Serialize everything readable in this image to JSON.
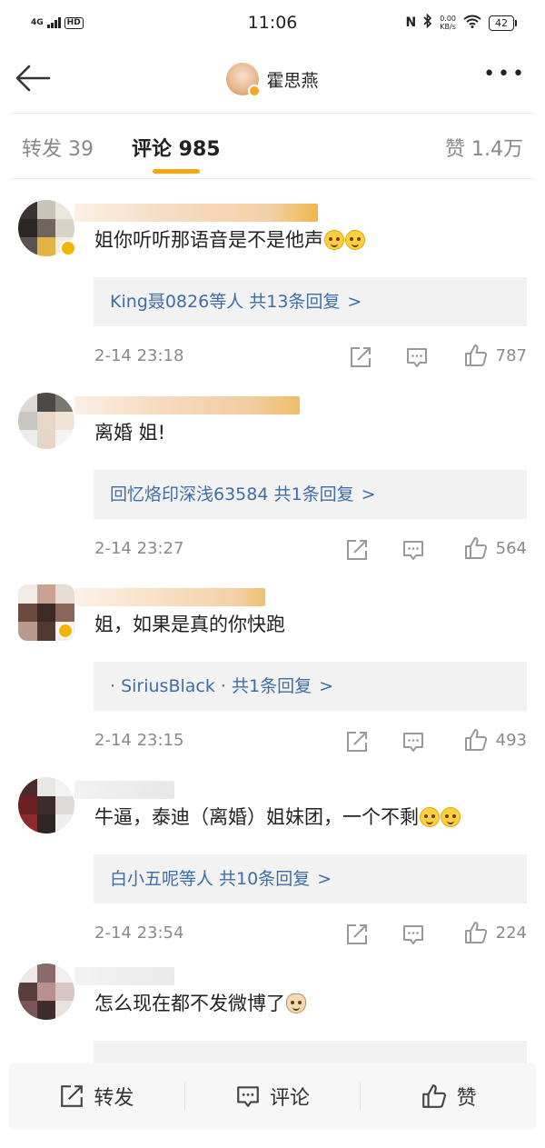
{
  "status_bar": {
    "network": "4G",
    "hd": "HD",
    "time": "11:06",
    "speed_value": "0.00",
    "speed_unit": "KB/s",
    "battery": "42"
  },
  "header": {
    "title": "霍思燕",
    "more": "•••"
  },
  "tabs": [
    {
      "label": "转发 39",
      "active": false
    },
    {
      "label": "评论 985",
      "active": true
    },
    {
      "label": "赞 1.4万",
      "active": false
    }
  ],
  "accent_color": "#f7a70f",
  "link_color": "#3d6ea8",
  "comments": [
    {
      "text": "姐你听听那语音是不是他声",
      "emojis": [
        "dizzy-face-emoji",
        "dizzy-face-emoji"
      ],
      "reply_summary": "King聂0826等人 共13条回复",
      "reply_chevron": ">",
      "time": "2-14 23:18",
      "likes": "787"
    },
    {
      "text": "离婚 姐!",
      "emojis": [],
      "reply_summary": "回忆烙印深浅63584 共1条回复",
      "reply_chevron": ">",
      "time": "2-14 23:27",
      "likes": "564"
    },
    {
      "text": "姐，如果是真的你快跑",
      "emojis": [],
      "reply_summary": "· SiriusBlack · 共1条回复",
      "reply_chevron": ">",
      "time": "2-14 23:15",
      "likes": "493"
    },
    {
      "text": "牛逼，泰迪（离婚）姐妹团，一个不剩",
      "emojis": [
        "sweat-smile-emoji",
        "sweat-smile-emoji"
      ],
      "reply_summary": "白小五呢等人 共10条回复",
      "reply_chevron": ">",
      "time": "2-14 23:54",
      "likes": "224"
    },
    {
      "text": "怎么现在都不发微博了",
      "emojis": [
        "cat-face-emoji"
      ],
      "reply_summary": "",
      "reply_chevron": "",
      "time": "",
      "likes": ""
    }
  ],
  "bottom_bar": {
    "repost_label": "转发",
    "comment_label": "评论",
    "like_label": "赞"
  }
}
